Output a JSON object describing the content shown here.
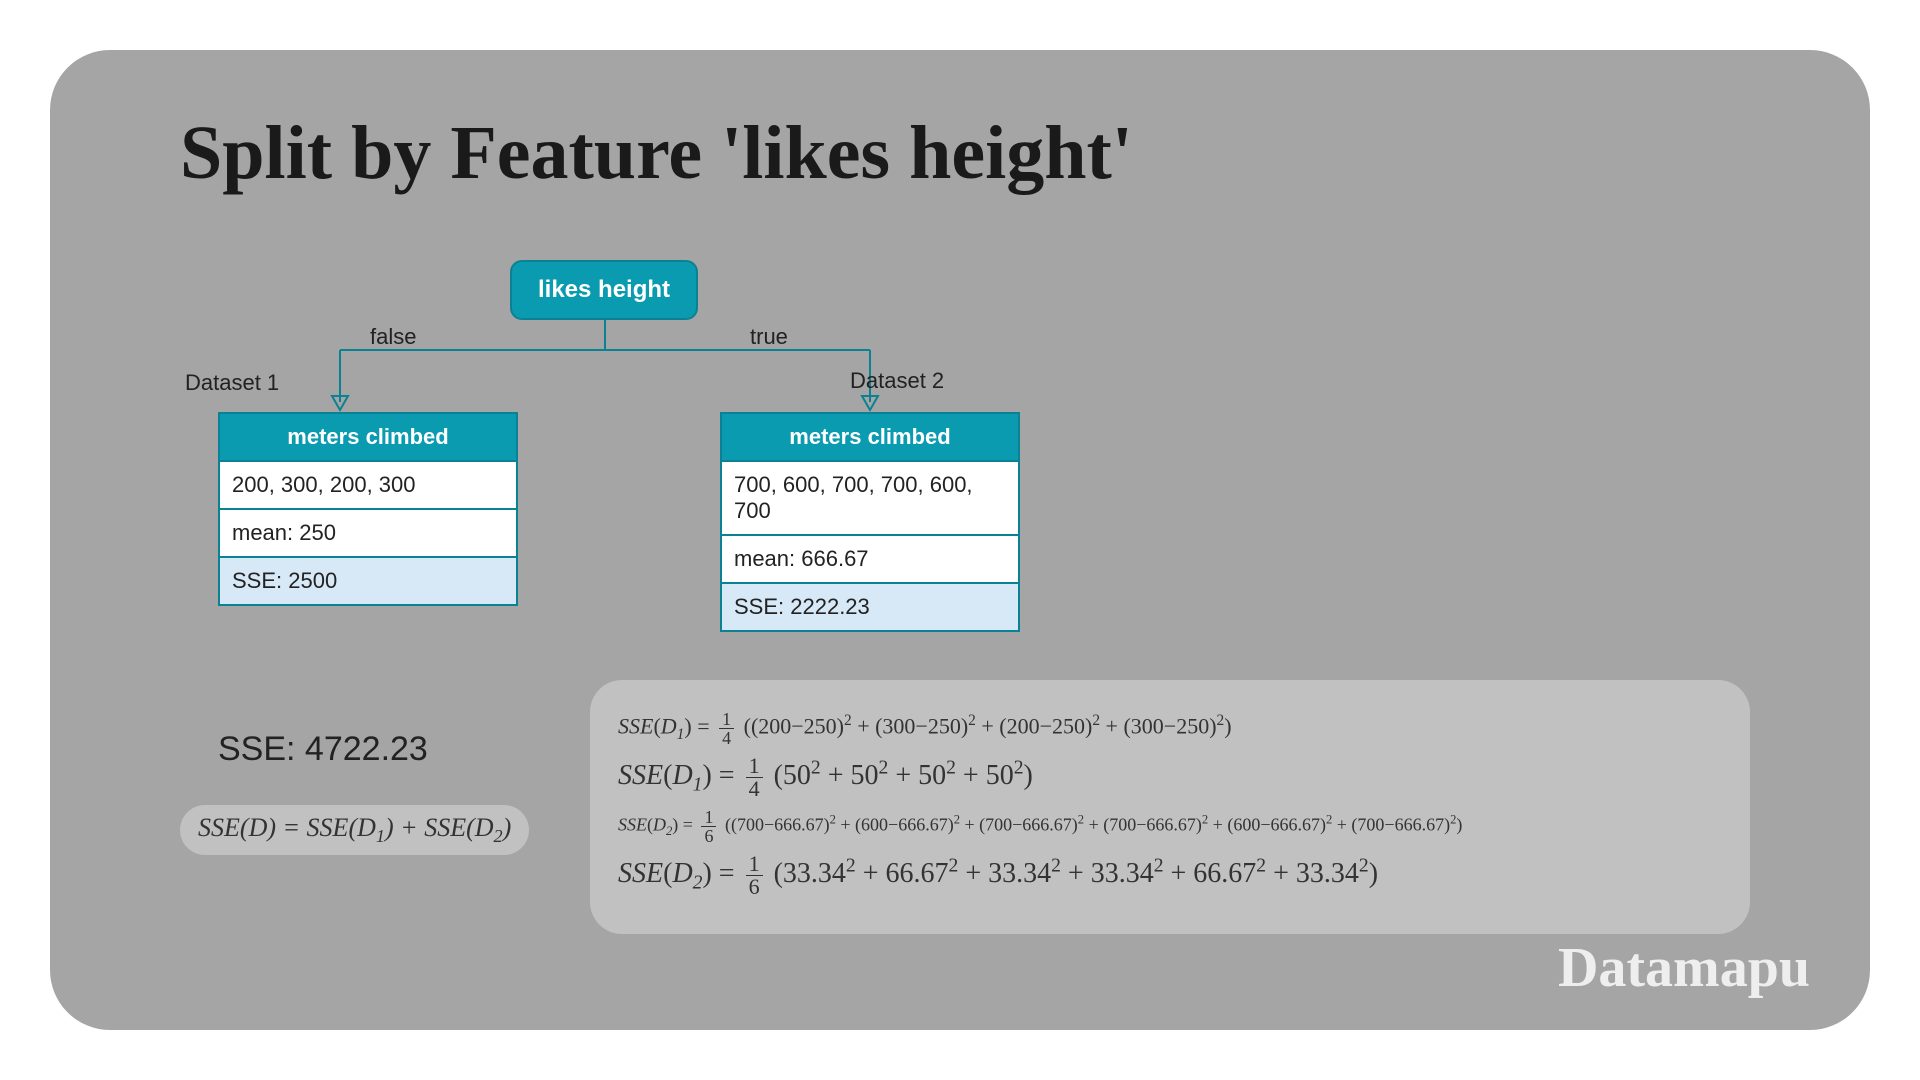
{
  "title": "Split by Feature 'likes height'",
  "root": {
    "label": "likes height"
  },
  "edges": {
    "false": "false",
    "true": "true"
  },
  "datasets": {
    "d1": {
      "label": "Dataset 1",
      "header": "meters climbed",
      "values": "200, 300, 200, 300",
      "mean": "mean: 250",
      "sse": "SSE: 2500"
    },
    "d2": {
      "label": "Dataset 2",
      "header": "meters climbed",
      "values": "700, 600, 700, 700, 600, 700",
      "mean": "mean: 666.67",
      "sse": "SSE: 2222.23"
    }
  },
  "total_sse": "SSE: 4722.23",
  "formula_sum": "SSE(D) = SSE(D₁) + SSE(D₂)",
  "math": {
    "line1_prefix": "SSE(D₁) = ",
    "line1_frac_top": "1",
    "line1_frac_bot": "4",
    "line1_body": "((200−250)² + (300−250)² + (200−250)² + (300−250)²)",
    "line2_prefix": "SSE(D₁) = ",
    "line2_frac_top": "1",
    "line2_frac_bot": "4",
    "line2_body": "(50² + 50² + 50² + 50²)",
    "line3_prefix": "SSE(D₂) = ",
    "line3_frac_top": "1",
    "line3_frac_bot": "6",
    "line3_body": "((700−666.67)² + (600−666.67)² + (700−666.67)² + (700−666.67)² + (600−666.67)² + (700−666.67)²)",
    "line4_prefix": "SSE(D₂) = ",
    "line4_frac_top": "1",
    "line4_frac_bot": "6",
    "line4_body": "(33.34² + 66.67² + 33.34² + 33.34² + 66.67² + 33.34²)"
  },
  "brand": "Datamapu"
}
